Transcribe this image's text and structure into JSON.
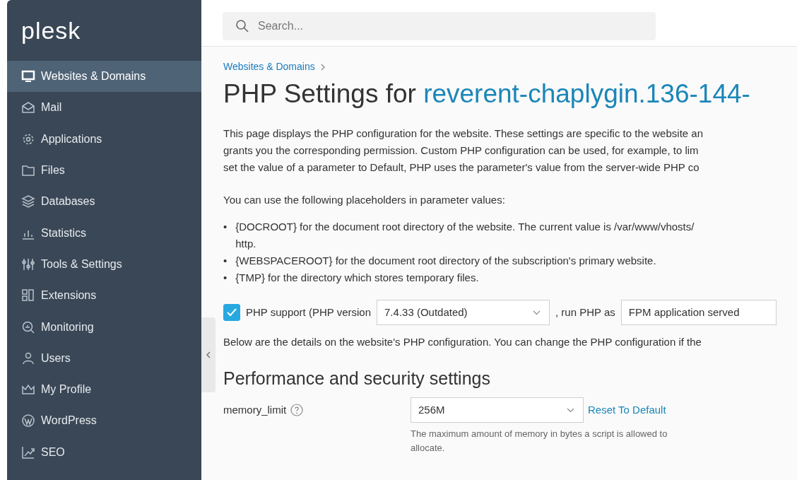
{
  "sidebar": {
    "logo": "plesk",
    "items": [
      {
        "label": "Websites & Domains",
        "selected": true
      },
      {
        "label": "Mail",
        "selected": false
      },
      {
        "label": "Applications",
        "selected": false
      },
      {
        "label": "Files",
        "selected": false
      },
      {
        "label": "Databases",
        "selected": false
      },
      {
        "label": "Statistics",
        "selected": false
      },
      {
        "label": "Tools & Settings",
        "selected": false
      },
      {
        "label": "Extensions",
        "selected": false
      },
      {
        "label": "Monitoring",
        "selected": false
      },
      {
        "label": "Users",
        "selected": false
      },
      {
        "label": "My Profile",
        "selected": false
      },
      {
        "label": "WordPress",
        "selected": false
      },
      {
        "label": "SEO",
        "selected": false
      }
    ]
  },
  "search": {
    "placeholder": "Search..."
  },
  "breadcrumb": [
    "Websites & Domains"
  ],
  "title": {
    "text": "PHP Settings for ",
    "domain": "reverent-chaplygin.136-144-"
  },
  "intro_lines": [
    "This page displays the PHP configuration for the website. These settings are specific to the website an",
    "grants you the corresponding permission. Custom PHP configuration can be used, for example, to lim",
    "set the value of a parameter to Default, PHP uses the parameter's value from the server-wide PHP co"
  ],
  "placeholders_intro": "You can use the following placeholders in parameter values:",
  "placeholders": [
    {
      "bullet": "•",
      "lines": [
        "{DOCROOT} for the document root directory of the website. The current value is /var/www/vhosts/",
        "http."
      ]
    },
    {
      "bullet": "•",
      "lines": [
        "{WEBSPACEROOT} for the document root directory of the subscription's primary website."
      ]
    },
    {
      "bullet": "•",
      "lines": [
        "{TMP} for the directory which stores temporary files."
      ]
    }
  ],
  "php_support": {
    "checked": true,
    "label": "PHP support (PHP version",
    "version": "7.4.33 (Outdated)",
    "run_as_label": ", run PHP as",
    "handler": "FPM application served"
  },
  "details_line": "Below are the details on the website's PHP configuration. You can change the PHP configuration if the",
  "section_title": "Performance and security settings",
  "settings": [
    {
      "name": "memory_limit",
      "value": "256M",
      "reset": "Reset To Default",
      "hint": "The maximum amount of memory in bytes a script is allowed to allocate."
    }
  ]
}
